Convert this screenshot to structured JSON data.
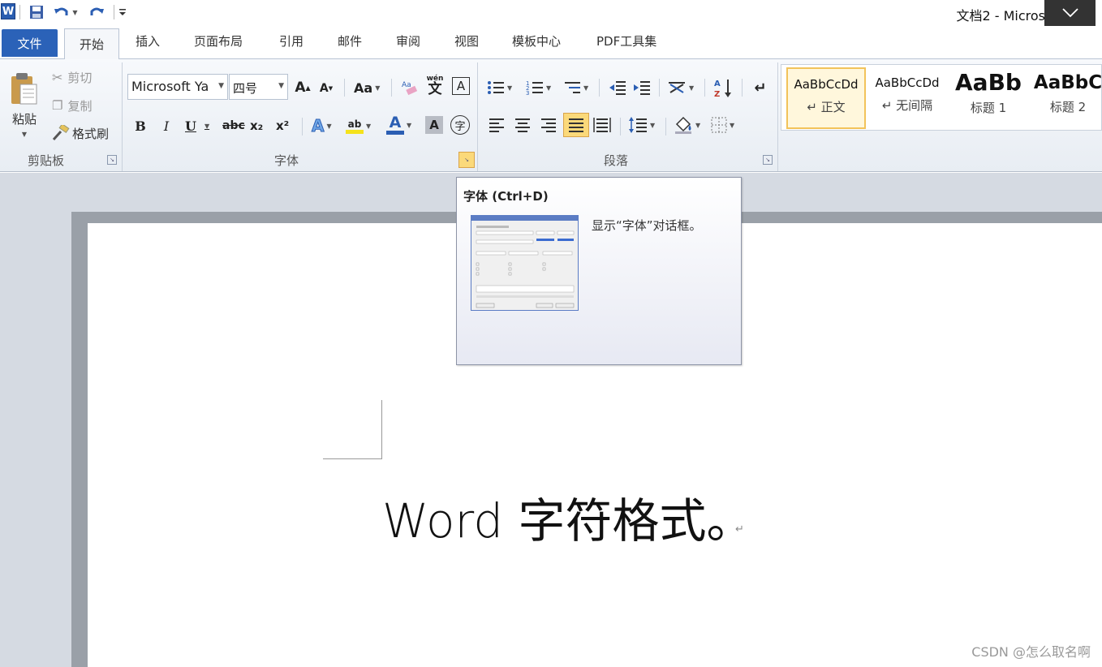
{
  "window": {
    "title": "文档2 - Micros"
  },
  "tabs": {
    "file": "文件",
    "home": "开始",
    "insert": "插入",
    "layout": "页面布局",
    "references": "引用",
    "mailings": "邮件",
    "review": "审阅",
    "view": "视图",
    "templates": "模板中心",
    "pdf": "PDF工具集"
  },
  "clipboard": {
    "paste": "粘贴",
    "cut": "剪切",
    "copy": "复制",
    "format_painter": "格式刷",
    "label": "剪贴板"
  },
  "font": {
    "name": "Microsoft Ya",
    "size": "四号",
    "label": "字体",
    "grow": "A",
    "shrink": "A",
    "change_case": "Aa",
    "bold": "B",
    "italic": "I",
    "underline": "U",
    "strikethrough": "abc",
    "subscript": "x₂",
    "superscript": "x²",
    "text_effects": "A",
    "highlight": "ab",
    "font_color": "A",
    "char_shading": "A",
    "enclose": "字",
    "phonetic": "wén",
    "char_border": "A"
  },
  "paragraph": {
    "label": "段落"
  },
  "styles": {
    "items": [
      {
        "sample": "AaBbCcDd",
        "name": "↵ 正文"
      },
      {
        "sample": "AaBbCcDd",
        "name": "↵ 无间隔"
      },
      {
        "sample": "AaBb",
        "name": "标题 1"
      },
      {
        "sample": "AaBbC",
        "name": "标题 2"
      }
    ]
  },
  "tooltip": {
    "title": "字体 (Ctrl+D)",
    "description": "显示“字体”对话框。"
  },
  "document": {
    "text": "Word 字符格式。",
    "para_mark": "↵"
  },
  "watermark": "CSDN @怎么取名啊",
  "colors": {
    "file_tab": "#2b62b8",
    "accent_highlight": "#fbd97a",
    "ribbon_bg": "#e8edf3"
  }
}
